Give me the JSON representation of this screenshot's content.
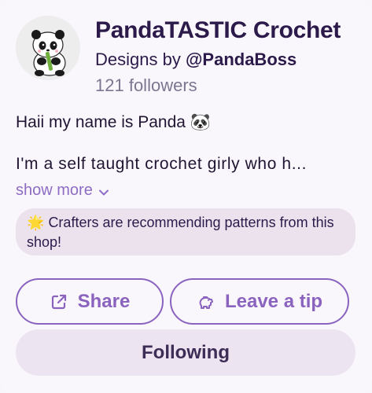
{
  "profile": {
    "shop_name": "PandaTASTIC Crochet",
    "designs_prefix": "Designs by ",
    "designer_handle": "@PandaBoss",
    "followers_count": "121",
    "followers_label": " followers"
  },
  "bio": {
    "line1": "Haii my name is Panda 🐼",
    "line2": "I'm a self taught crochet girly who h...",
    "show_more_label": "show more"
  },
  "recommendation": {
    "icon": "🌟",
    "text": "Crafters are recommending patterns from this shop!"
  },
  "actions": {
    "share_label": "Share",
    "tip_label": "Leave a tip",
    "following_label": "Following"
  },
  "colors": {
    "accent": "#8a63bf",
    "title": "#2b1a4a",
    "muted": "#7c7690",
    "pill_bg": "#ece2ee"
  },
  "icons": {
    "share": "external-link-icon",
    "tip": "piggy-bank-icon",
    "show_more": "chevron-down-icon",
    "avatar": "panda-avatar"
  }
}
